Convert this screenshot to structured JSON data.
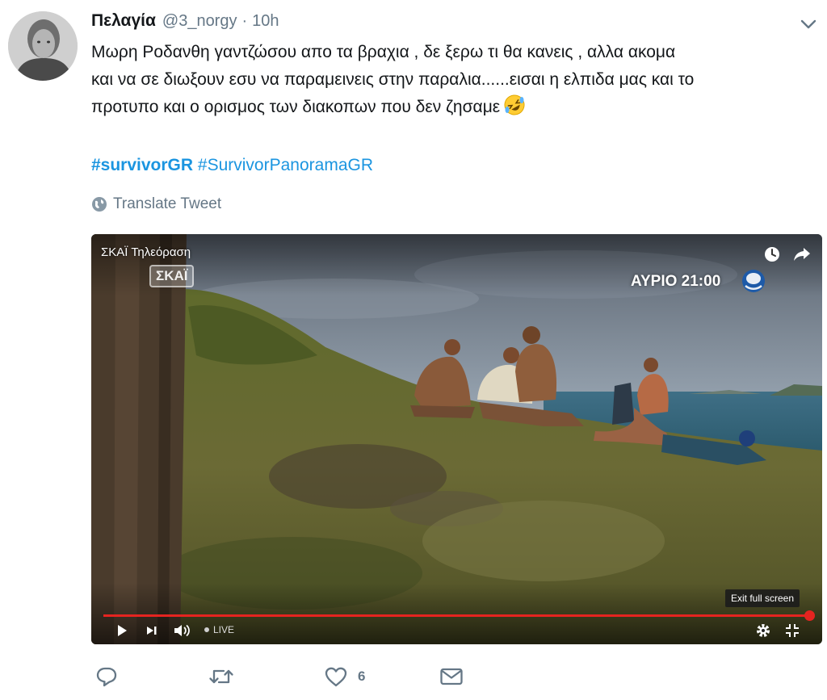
{
  "tweet": {
    "author": {
      "display_name": "Πελαγία",
      "handle": "@3_norgy",
      "separator": "·",
      "time": "10h"
    },
    "text_lines": [
      "Μωρη Ροδανθη γαντζώσου απο τα βραχια , δε ξερω τι θα κανεις , αλλα ακομα",
      "και να σε διωξουν εσυ να παραμεινεις στην παραλια......εισαι η ελπιδα μας και το",
      "προτυπο και ο ορισμος των διακοπων που δεν ζησαμε"
    ],
    "emoji": "rolling-on-floor-laughing",
    "hashtags": [
      "#survivorGR",
      "#SurvivorPanoramaGR"
    ],
    "translate_label": "Translate Tweet"
  },
  "video": {
    "channel_title": "ΣΚΑΪ Τηλεόραση",
    "channel_logo": "ΣΚΑΪ",
    "promo_text": "ΑΥΡΙΟ 21:00",
    "exit_fullscreen_tooltip": "Exit full screen",
    "live_label": "LIVE",
    "progress": 1.0,
    "icons": {
      "play": "play-icon",
      "next": "next-icon",
      "volume": "volume-icon",
      "settings": "gear-icon",
      "exit_fullscreen": "exit-fullscreen-icon",
      "watch_later": "clock-icon",
      "share": "share-icon"
    }
  },
  "actions": {
    "like_count": "6",
    "icons": [
      "reply-icon",
      "retweet-icon",
      "heart-icon",
      "direct-message-icon"
    ]
  },
  "colors": {
    "link": "#1b95e0",
    "secondary_text": "#657786",
    "primary_text": "#14171a",
    "progress": "#e52420"
  }
}
